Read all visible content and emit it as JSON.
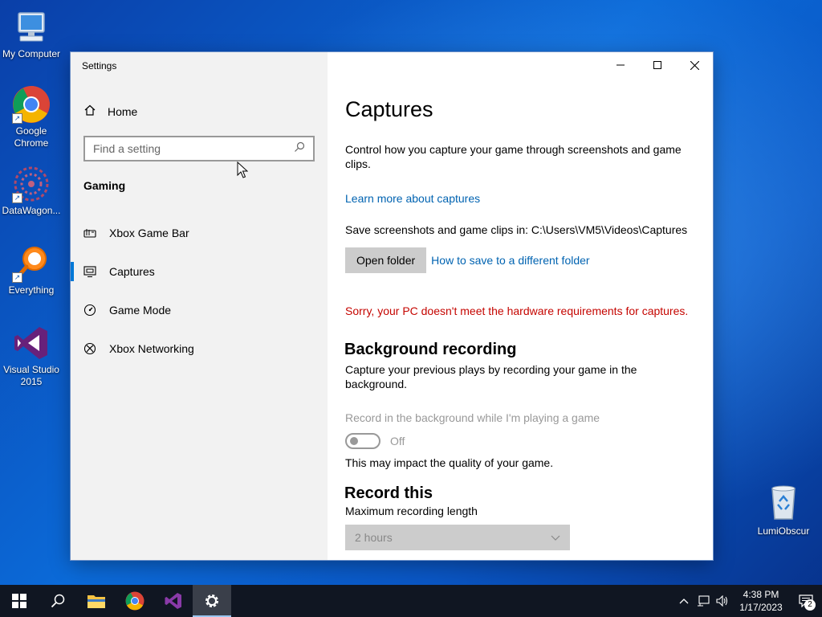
{
  "desktop": {
    "icons": [
      {
        "label": "My Computer"
      },
      {
        "label": "Google Chrome"
      },
      {
        "label": "DataWagon..."
      },
      {
        "label": "Everything"
      },
      {
        "label": "Visual Studio 2015"
      }
    ],
    "recycle_bin": {
      "label": "LumiObscur"
    }
  },
  "window": {
    "title": "Settings",
    "nav": {
      "home_label": "Home",
      "search_placeholder": "Find a setting",
      "section_title": "Gaming",
      "items": [
        {
          "label": "Xbox Game Bar",
          "icon": "game-bar-icon"
        },
        {
          "label": "Captures",
          "icon": "captures-icon",
          "active": true
        },
        {
          "label": "Game Mode",
          "icon": "game-mode-icon"
        },
        {
          "label": "Xbox Networking",
          "icon": "xbox-icon"
        }
      ]
    },
    "content": {
      "title": "Captures",
      "description": "Control how you capture your game through screenshots and game clips.",
      "learn_more_link": "Learn more about captures",
      "save_path_text": "Save screenshots and game clips in: C:\\Users\\VM5\\Videos\\Captures",
      "open_folder_button": "Open folder",
      "different_folder_link": "How to save to a different folder",
      "error_message": "Sorry, your PC doesn't meet the hardware requirements for captures.",
      "background_recording": {
        "title": "Background recording",
        "description": "Capture your previous plays by recording your game in the background.",
        "toggle_label": "Record in the background while I'm playing a game",
        "toggle_state": "Off",
        "impact_note": "This may impact the quality of your game."
      },
      "record_this": {
        "title": "Record this",
        "max_length_label": "Maximum recording length",
        "max_length_value": "2 hours"
      }
    }
  },
  "taskbar": {
    "clock_time": "4:38 PM",
    "clock_date": "1/17/2023",
    "notification_count": "2"
  },
  "colors": {
    "accent": "#0078d7",
    "link": "#0063b1",
    "error": "#c50500",
    "taskbar": "#101622"
  }
}
